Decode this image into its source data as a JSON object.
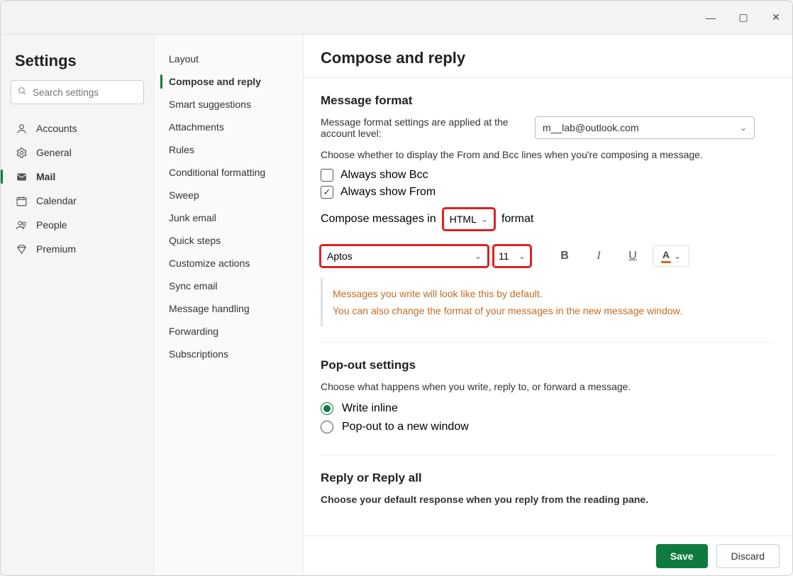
{
  "window": {
    "minimize": "—",
    "maximize": "▢",
    "close": "✕"
  },
  "sidebar": {
    "title": "Settings",
    "search_placeholder": "Search settings",
    "items": [
      {
        "id": "accounts",
        "label": "Accounts",
        "icon": "person"
      },
      {
        "id": "general",
        "label": "General",
        "icon": "gear"
      },
      {
        "id": "mail",
        "label": "Mail",
        "icon": "mail",
        "active": true
      },
      {
        "id": "calendar",
        "label": "Calendar",
        "icon": "calendar"
      },
      {
        "id": "people",
        "label": "People",
        "icon": "people"
      },
      {
        "id": "premium",
        "label": "Premium",
        "icon": "diamond"
      }
    ]
  },
  "subnav": {
    "items": [
      {
        "id": "layout",
        "label": "Layout"
      },
      {
        "id": "compose",
        "label": "Compose and reply",
        "active": true
      },
      {
        "id": "smart",
        "label": "Smart suggestions"
      },
      {
        "id": "attachments",
        "label": "Attachments"
      },
      {
        "id": "rules",
        "label": "Rules"
      },
      {
        "id": "conditional",
        "label": "Conditional formatting"
      },
      {
        "id": "sweep",
        "label": "Sweep"
      },
      {
        "id": "junk",
        "label": "Junk email"
      },
      {
        "id": "quick",
        "label": "Quick steps"
      },
      {
        "id": "customize",
        "label": "Customize actions"
      },
      {
        "id": "sync",
        "label": "Sync email"
      },
      {
        "id": "handling",
        "label": "Message handling"
      },
      {
        "id": "forwarding",
        "label": "Forwarding"
      },
      {
        "id": "subscriptions",
        "label": "Subscriptions"
      }
    ]
  },
  "main": {
    "title": "Compose and reply",
    "message_format": {
      "heading": "Message format",
      "desc": "Message format settings are applied at the account level:",
      "account_selected": "m__lab@outlook.com",
      "hint": "Choose whether to display the From and Bcc lines when you're composing a message.",
      "always_bcc_label": "Always show Bcc",
      "always_bcc_checked": false,
      "always_from_label": "Always show From",
      "always_from_checked": true,
      "compose_in_pre": "Compose messages in",
      "compose_in_value": "HTML",
      "compose_in_post": "format",
      "font_name": "Aptos",
      "font_size": "11",
      "preview_line1": "Messages you write will look like this by default.",
      "preview_line2": "You can also change the format of your messages in the new message window."
    },
    "popout": {
      "heading": "Pop-out settings",
      "desc": "Choose what happens when you write, reply to, or forward a message.",
      "opt_inline": "Write inline",
      "opt_popout": "Pop-out to a new window",
      "selected": "inline"
    },
    "reply": {
      "heading": "Reply or Reply all",
      "desc": "Choose your default response when you reply from the reading pane."
    }
  },
  "footer": {
    "save": "Save",
    "discard": "Discard"
  }
}
